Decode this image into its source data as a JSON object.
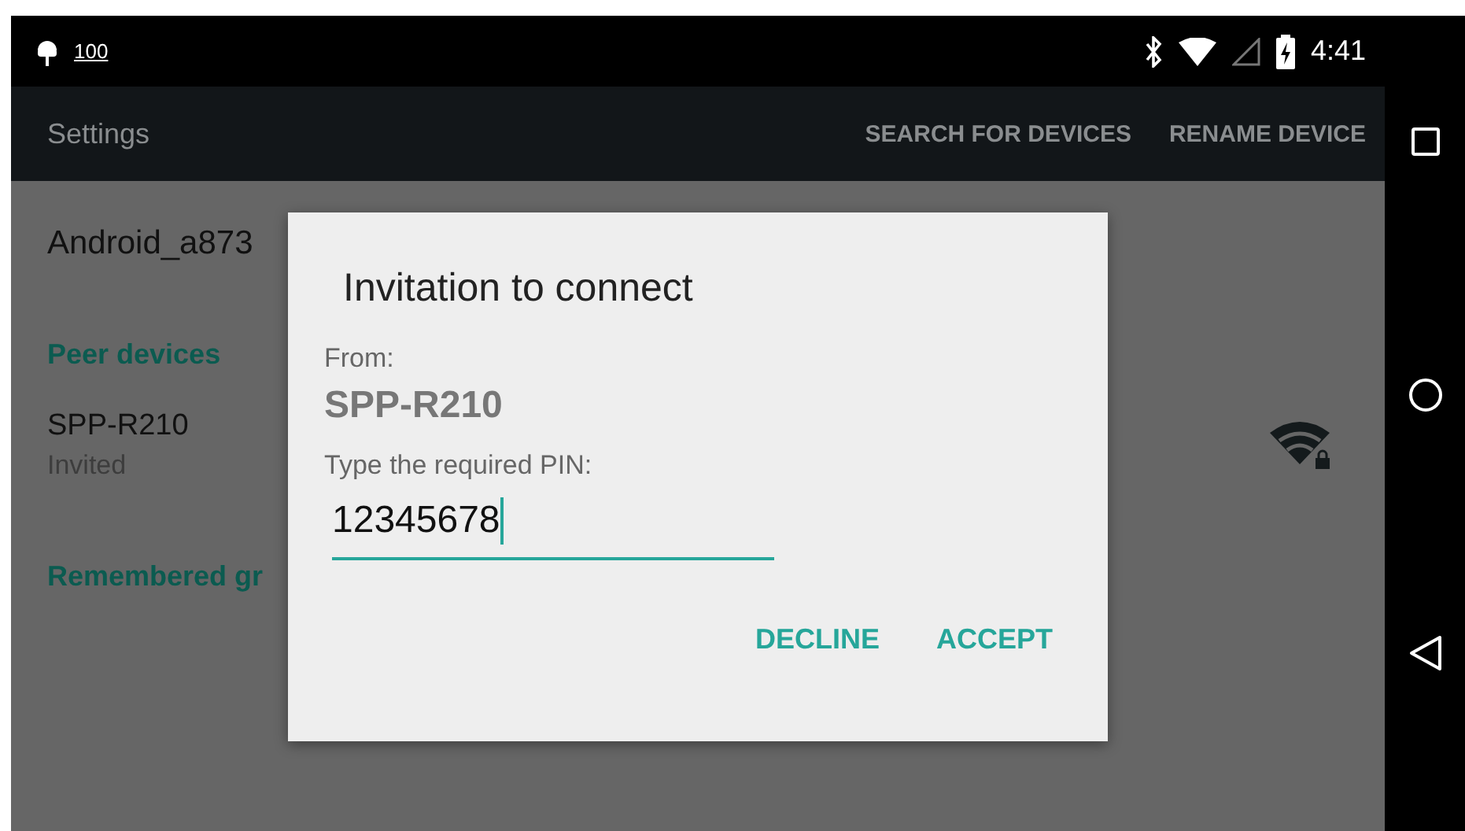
{
  "status_bar": {
    "battery_text": "100",
    "time": "4:41"
  },
  "action_bar": {
    "title": "Settings",
    "actions": [
      "SEARCH FOR DEVICES",
      "RENAME DEVICE"
    ]
  },
  "content": {
    "device_name": "Android_a873",
    "peer_header": "Peer devices",
    "peers": [
      {
        "name": "SPP-R210",
        "status": "Invited"
      }
    ],
    "remembered_header": "Remembered gr"
  },
  "dialog": {
    "title": "Invitation to connect",
    "from_label": "From:",
    "from_value": "SPP-R210",
    "pin_label": "Type the required PIN:",
    "pin_value": "12345678",
    "buttons": [
      "DECLINE",
      "ACCEPT"
    ]
  }
}
